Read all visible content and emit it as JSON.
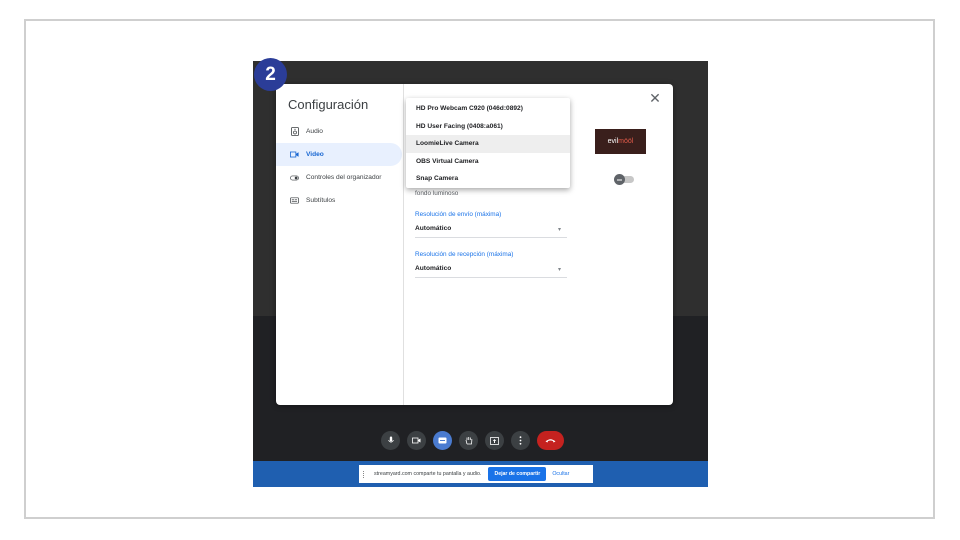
{
  "step": {
    "number": "2"
  },
  "dialog": {
    "title": "Configuración",
    "close_icon": "close-icon",
    "nav": [
      {
        "label": "Audio",
        "icon": "speaker-icon"
      },
      {
        "label": "Video",
        "icon": "video-camera-icon",
        "active": true
      },
      {
        "label": "Controles del organizador",
        "icon": "toggle-icon"
      },
      {
        "label": "Subtítulos",
        "icon": "captions-icon"
      }
    ],
    "content": {
      "partial_text": "fondo luminoso",
      "send_resolution": {
        "label": "Resolución de envío (máxima)",
        "value": "Automático"
      },
      "receive_resolution": {
        "label": "Resolución de recepción (máxima)",
        "value": "Automático"
      },
      "preview": {
        "brand_left": "evil",
        "brand_right": "mööl"
      }
    },
    "camera_dropdown": {
      "options": [
        "HD Pro Webcam C920 (046d:0892)",
        "HD User Facing (0408:a061)",
        "LoomieLive Camera",
        "OBS Virtual Camera",
        "Snap Camera"
      ],
      "highlighted": "LoomieLive Camera"
    }
  },
  "share_bar": {
    "message": "streamyard.com comparte tu pantalla y audio.",
    "stop_label": "Dejar de compartir",
    "hide_label": "Ocultar"
  },
  "colors": {
    "accent": "#1a73e8",
    "badge": "#2b3d98",
    "end_call": "#c5221f",
    "share_bar": "#1f5fb0"
  }
}
